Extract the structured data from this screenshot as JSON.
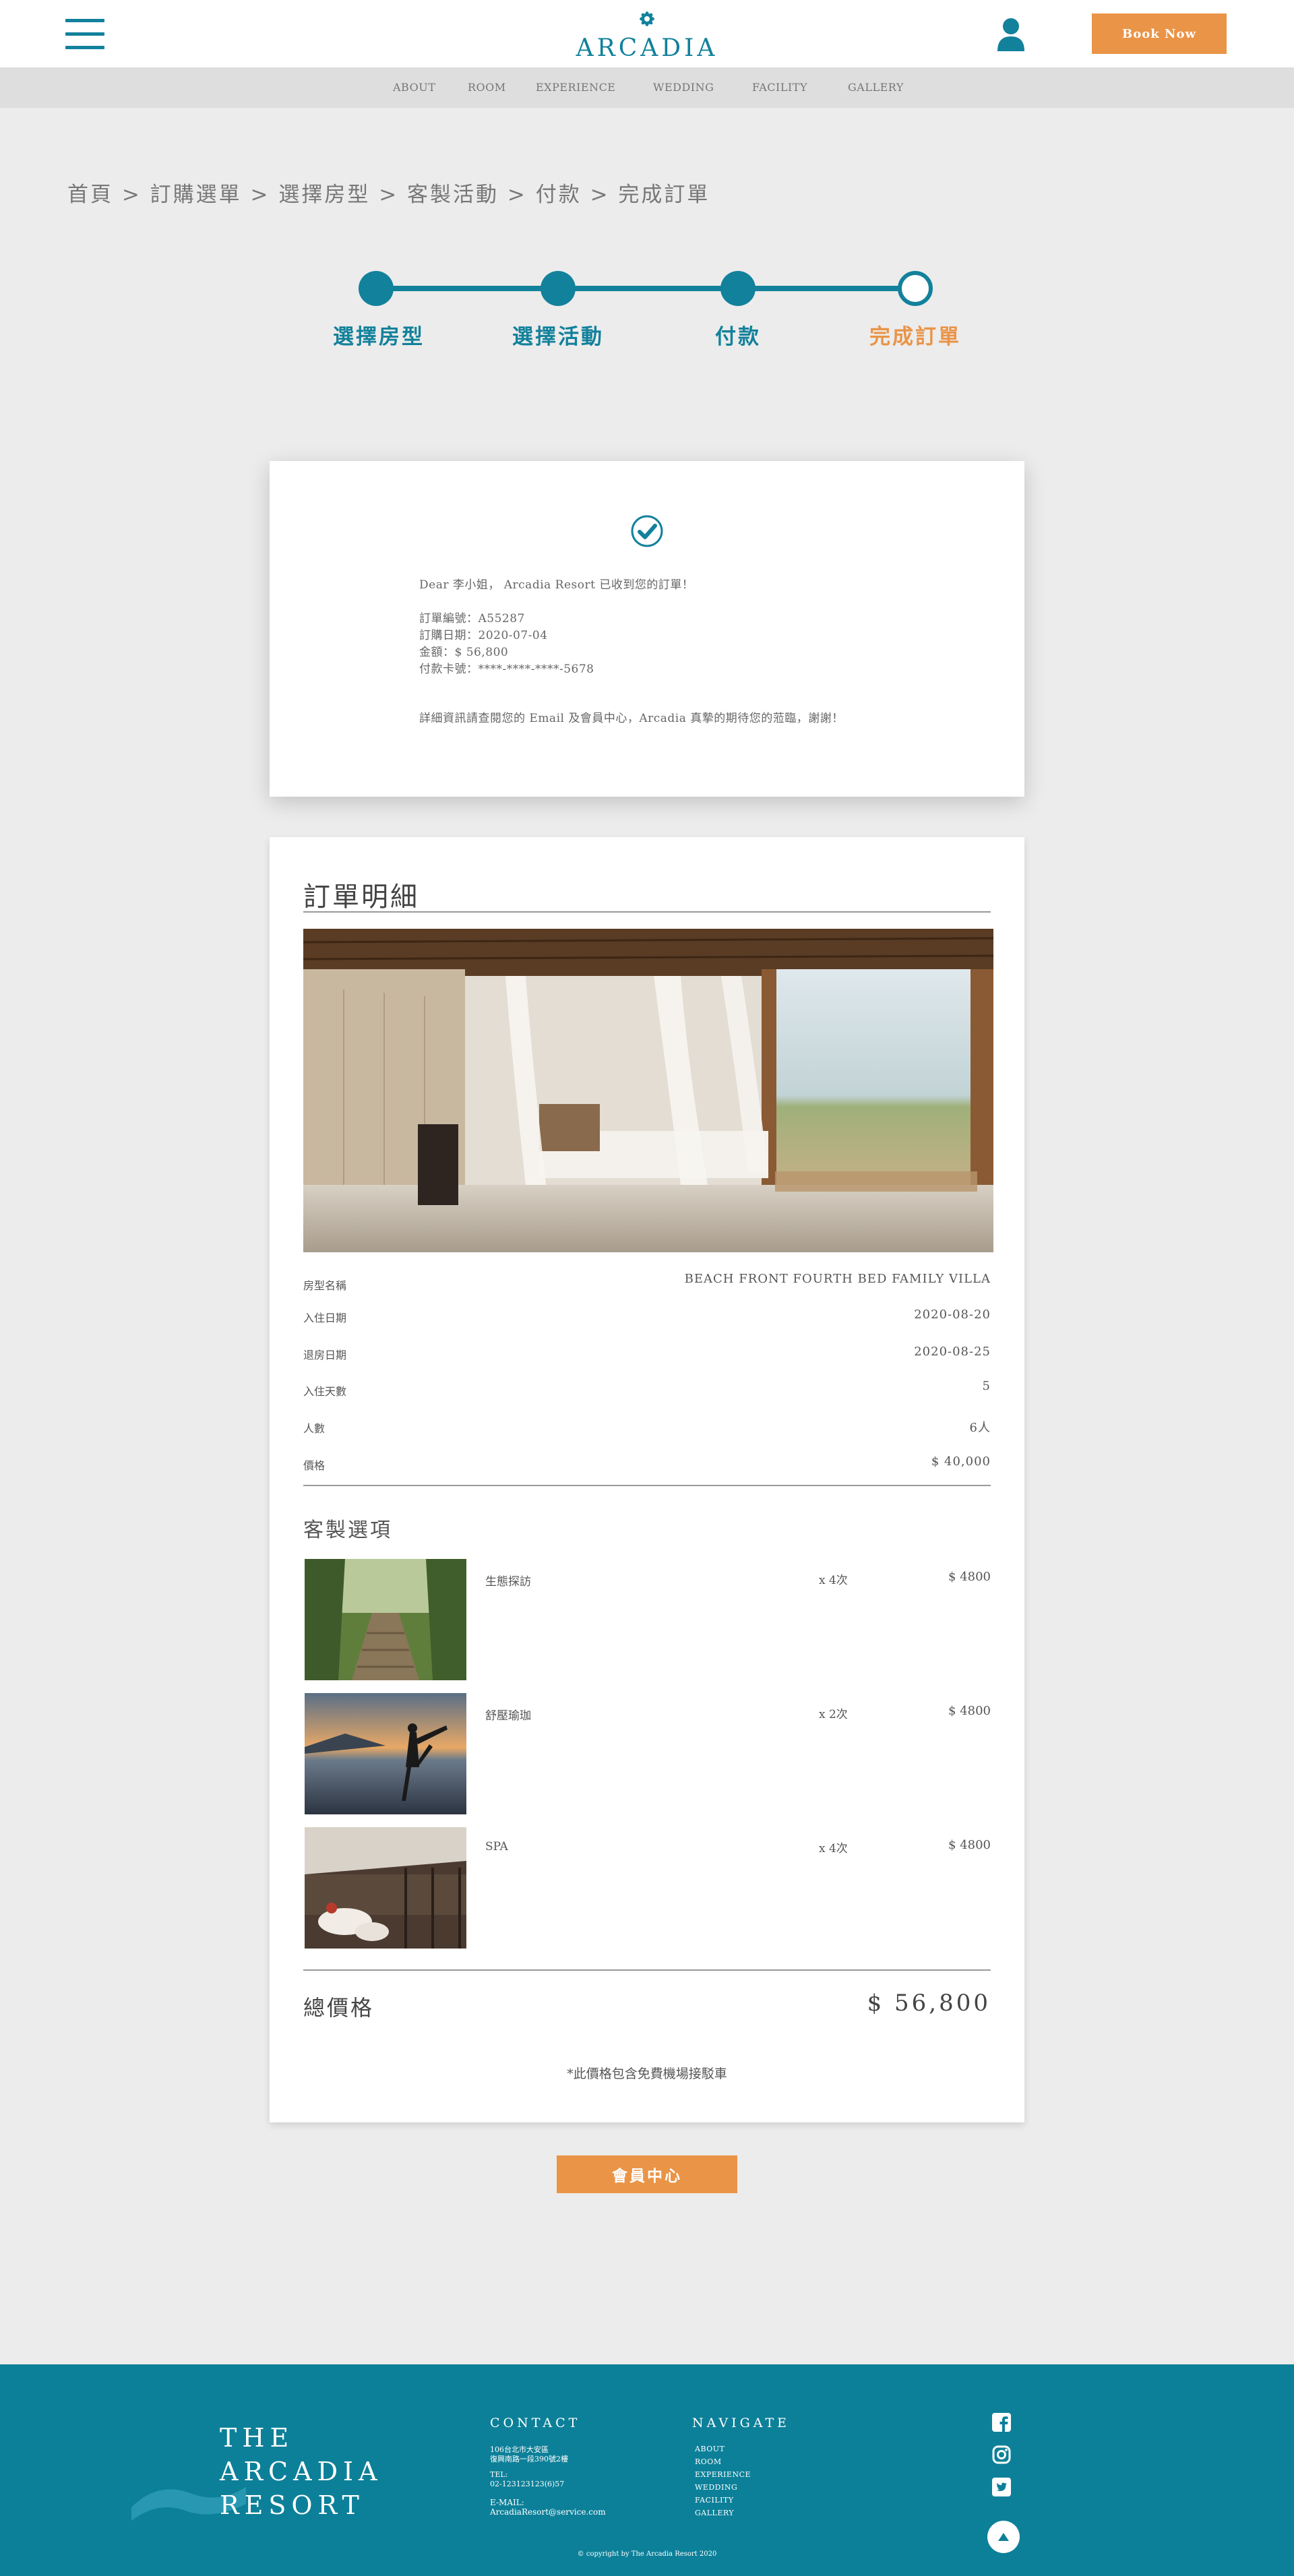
{
  "header": {
    "logo_text": "ARCADIA",
    "book_label": "Book Now",
    "nav": [
      "ABOUT",
      "ROOM",
      "EXPERIENCE",
      "WEDDING",
      "FACILITY",
      "GALLERY"
    ]
  },
  "breadcrumb": "首頁 > 訂購選單 > 選擇房型 > 客製活動 > 付款 > 完成訂單",
  "steps": [
    "選擇房型",
    "選擇活動",
    "付款",
    "完成訂單"
  ],
  "confirmation": {
    "greeting": "Dear 李小姐， Arcadia Resort 已收到您的訂單！",
    "order_no": "訂單編號：A55287",
    "order_date": "訂購日期：2020-07-04",
    "amount": "金額：$ 56,800",
    "card": "付款卡號：****-****-****-5678",
    "message": "詳細資訊請查閱您的 Email 及會員中心，Arcadia 真摯的期待您的蒞臨，謝謝！"
  },
  "detail": {
    "title": "訂單明細",
    "rows": [
      {
        "label": "房型名稱",
        "value": "BEACH FRONT FOURTH BED FAMILY VILLA"
      },
      {
        "label": "入住日期",
        "value": "2020-08-20"
      },
      {
        "label": "退房日期",
        "value": "2020-08-25"
      },
      {
        "label": "入住天數",
        "value": "5"
      },
      {
        "label": "人數",
        "value": "6人"
      },
      {
        "label": "價格",
        "value": "$ 40,000"
      }
    ],
    "options_title": "客製選項",
    "options": [
      {
        "name": "生態探訪",
        "qty": "x 4次",
        "price": "$ 4800"
      },
      {
        "name": "舒壓瑜珈",
        "qty": "x 2次",
        "price": "$ 4800"
      },
      {
        "name": "SPA",
        "qty": "x 4次",
        "price": "$ 4800"
      }
    ],
    "total_label": "總價格",
    "total_value": "$ 56,800",
    "note": "*此價格包含免費機場接駁車"
  },
  "member_label": "會員中心",
  "footer": {
    "logo": [
      "THE",
      "ARCADIA",
      "RESORT"
    ],
    "contact_title": "CONTACT",
    "address": [
      "106台北市大安區",
      "復興南路一段390號2樓"
    ],
    "tel_label": "TEL:",
    "tel": "02-123123123(6)57",
    "email_label": "E-MAIL:",
    "email": "ArcadiaResort@service.com",
    "navigate_title": "NAVIGATE",
    "nav": [
      "ABOUT",
      "ROOM",
      "EXPERIENCE",
      "WEDDING",
      "FACILITY",
      "GALLERY"
    ],
    "copyright": "© copyright by The Arcadia Resort 2020"
  },
  "colors": {
    "teal": "#12819b",
    "orange": "#ea9447",
    "footer": "#0d8099"
  },
  "icons": [
    "hamburger-icon",
    "logo-flower-icon",
    "user-icon",
    "check-circle-icon",
    "facebook-icon",
    "instagram-icon",
    "twitter-icon",
    "arrow-up-icon"
  ]
}
